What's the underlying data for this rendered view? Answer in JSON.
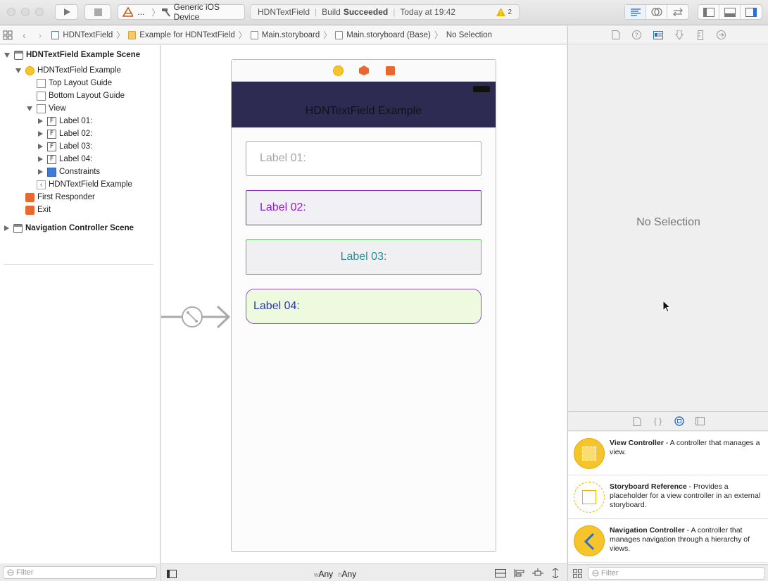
{
  "toolbar": {
    "scheme_target": "...",
    "device": "Generic iOS Device",
    "activity": {
      "project": "HDNTextField",
      "status_prefix": "Build",
      "status_result": "Succeeded",
      "time": "Today at 19:42",
      "warning_count": "2"
    }
  },
  "jumpbar": {
    "crumbs": [
      "HDNTextField",
      "Example for HDNTextField",
      "Main.storyboard",
      "Main.storyboard (Base)",
      "No Selection"
    ]
  },
  "outline": {
    "items": [
      {
        "label": "HDNTextField Example Scene"
      },
      {
        "label": "HDNTextField Example"
      },
      {
        "label": "Top Layout Guide"
      },
      {
        "label": "Bottom Layout Guide"
      },
      {
        "label": "View"
      },
      {
        "label": "Label 01:"
      },
      {
        "label": "Label 02:"
      },
      {
        "label": "Label 03:"
      },
      {
        "label": "Label 04:"
      },
      {
        "label": "Constraints"
      },
      {
        "label": "HDNTextField Example"
      },
      {
        "label": "First Responder"
      },
      {
        "label": "Exit"
      },
      {
        "label": "Navigation Controller Scene"
      }
    ],
    "filter_placeholder": "Filter"
  },
  "canvas": {
    "nav_title": "HDNTextField Example",
    "fields": [
      {
        "label": "Label 01:",
        "color": "#a6a6a6",
        "border": "#a9a9a9",
        "bg": "#ffffff"
      },
      {
        "label": "Label 02:",
        "color": "#8a1fd0",
        "border": "#8a2bbf",
        "bg": "#f1f0f5"
      },
      {
        "label": "Label 03:",
        "color": "#2a8c92",
        "border": "#5cb85c",
        "bg": "#f0f0f3"
      },
      {
        "label": "Label 04:",
        "color": "#2d35b5",
        "border": "#9a4fd0",
        "bg": "#edfadd"
      }
    ],
    "size_class_w_prefix": "w",
    "size_class_w": "Any",
    "size_class_h_prefix": "h",
    "size_class_h": "Any"
  },
  "inspector": {
    "empty_text": "No Selection"
  },
  "library": {
    "items": [
      {
        "title": "View Controller",
        "desc": " - A controller that manages a view."
      },
      {
        "title": "Storyboard Reference",
        "desc": " - Provides a placeholder for a view controller in an external storyboard."
      },
      {
        "title": "Navigation Controller",
        "desc": " - A controller that manages navigation through a hierarchy of views."
      }
    ],
    "filter_placeholder": "Filter"
  },
  "colors": {
    "navbar": "#2e2b52",
    "accent": "#3b7dd8",
    "vc_yellow": "#f6c52b",
    "orange": "#e8692d"
  }
}
